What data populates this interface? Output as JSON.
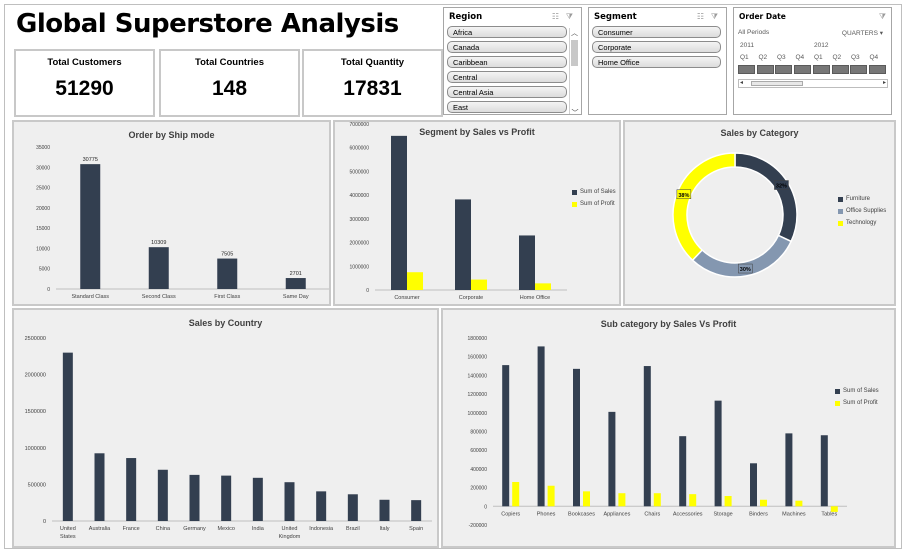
{
  "dashboard": {
    "title": "Global Superstore Analysis"
  },
  "kpis": [
    {
      "label": "Total Customers",
      "value": "51290"
    },
    {
      "label": "Total Countries",
      "value": "148"
    },
    {
      "label": "Total Quantity",
      "value": "17831"
    }
  ],
  "region_slicer": {
    "title": "Region",
    "items": [
      "Africa",
      "Canada",
      "Caribbean",
      "Central",
      "Central Asia",
      "East"
    ]
  },
  "segment_slicer": {
    "title": "Segment",
    "items": [
      "Consumer",
      "Corporate",
      "Home Office"
    ]
  },
  "order_date": {
    "title": "Order Date",
    "periods_label": "All Periods",
    "level_label": "QUARTERS",
    "years": [
      "2011",
      "2012"
    ],
    "quarters": [
      "Q1",
      "Q2",
      "Q3",
      "Q4",
      "Q1",
      "Q2",
      "Q3",
      "Q4"
    ]
  },
  "colors": {
    "navy": "#333f50",
    "yellow": "#ffff00",
    "steel": "#8497b0"
  },
  "chart_data": [
    {
      "id": "ship",
      "type": "bar",
      "title": "Order by Ship mode",
      "categories": [
        "Standard Class",
        "Second Class",
        "First Class",
        "Same Day"
      ],
      "series": [
        {
          "values": [
            30775,
            10309,
            7505,
            2701
          ]
        }
      ],
      "data_labels": [
        "30775",
        "10309",
        "7505",
        "2701"
      ],
      "ylim": [
        0,
        35000
      ],
      "yticks": [
        0,
        5000,
        10000,
        15000,
        20000,
        25000,
        30000,
        35000
      ],
      "ytick_labels": [
        "0",
        "5000",
        "10000",
        "15000",
        "20000",
        "25000",
        "30000",
        "35000"
      ]
    },
    {
      "id": "segment",
      "type": "bar",
      "title": "Segment by Sales vs Profit",
      "categories": [
        "Consumer",
        "Corporate",
        "Home Office"
      ],
      "series": [
        {
          "name": "Sum of Sales",
          "values": [
            6500000,
            3820000,
            2300000
          ]
        },
        {
          "name": "Sum of Profit",
          "values": [
            750000,
            440000,
            280000
          ]
        }
      ],
      "ylim": [
        0,
        7000000
      ],
      "yticks": [
        0,
        1000000,
        2000000,
        3000000,
        4000000,
        5000000,
        6000000,
        7000000
      ],
      "ytick_labels": [
        "0",
        "1000000",
        "2000000",
        "3000000",
        "4000000",
        "5000000",
        "6000000",
        "7000000"
      ]
    },
    {
      "id": "category",
      "type": "pie",
      "title": "Sales by Category",
      "categories": [
        "Furniture",
        "Office Supplies",
        "Technology"
      ],
      "values": [
        32,
        30,
        38
      ],
      "data_labels": [
        "32%",
        "30%",
        "38%"
      ]
    },
    {
      "id": "country",
      "type": "bar",
      "title": "Sales by Country",
      "categories": [
        "United States",
        "Australia",
        "France",
        "China",
        "Germany",
        "Mexico",
        "India",
        "United Kingdom",
        "Indonesia",
        "Brazil",
        "Italy",
        "Spain"
      ],
      "series": [
        {
          "values": [
            2300000,
            925000,
            860000,
            700000,
            630000,
            620000,
            590000,
            530000,
            405000,
            365000,
            290000,
            285000
          ]
        }
      ],
      "ylim": [
        0,
        2500000
      ],
      "yticks": [
        0,
        500000,
        1000000,
        1500000,
        2000000,
        2500000
      ],
      "ytick_labels": [
        "0",
        "500000",
        "1000000",
        "1500000",
        "2000000",
        "2500000"
      ]
    },
    {
      "id": "subcat",
      "type": "bar",
      "title": "Sub category by Sales Vs Profit",
      "categories": [
        "Copiers",
        "Phones",
        "Bookcases",
        "Appliances",
        "Chairs",
        "Accessories",
        "Storage",
        "Binders",
        "Machines",
        "Tables"
      ],
      "series": [
        {
          "name": "Sum of Sales",
          "values": [
            1510000,
            1710000,
            1470000,
            1010000,
            1500000,
            750000,
            1130000,
            460000,
            780000,
            760000
          ]
        },
        {
          "name": "Sum of Profit",
          "values": [
            260000,
            220000,
            160000,
            140000,
            140000,
            130000,
            110000,
            70000,
            60000,
            -60000
          ]
        }
      ],
      "ylim": [
        -200000,
        1800000
      ],
      "yticks": [
        -200000,
        0,
        200000,
        400000,
        600000,
        800000,
        1000000,
        1200000,
        1400000,
        1600000,
        1800000
      ],
      "ytick_labels": [
        "-200000",
        "0",
        "200000",
        "400000",
        "600000",
        "800000",
        "1000000",
        "1200000",
        "1400000",
        "1600000",
        "1800000"
      ]
    }
  ]
}
